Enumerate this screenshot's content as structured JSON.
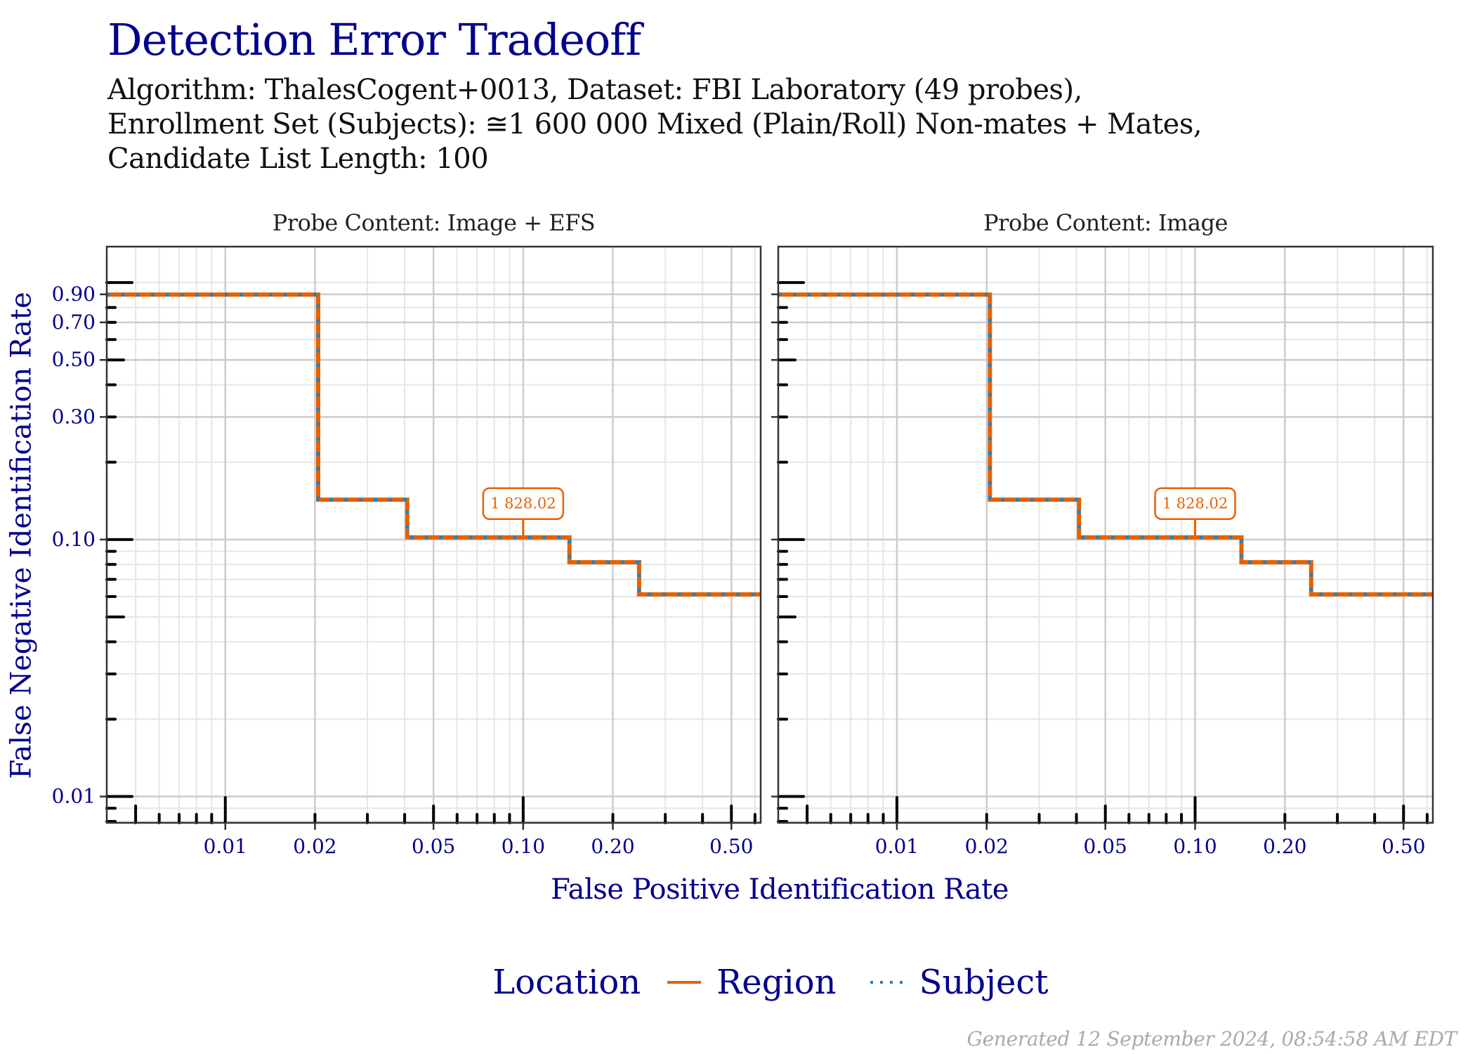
{
  "title": "Detection Error Tradeoff",
  "subtitle_lines": [
    "Algorithm: ThalesCogent+0013, Dataset: FBI Laboratory (49 probes),",
    "Enrollment Set (Subjects):  ≅1 600 000 Mixed (Plain/Roll) Non-mates + Mates,",
    "Candidate List Length: 100"
  ],
  "footer": "Generated 12 September 2024, 08:54:58 AM EDT",
  "legend": {
    "title": "Location",
    "items": [
      {
        "label": "Region",
        "color": "#E66100",
        "linetype": "solid"
      },
      {
        "label": "Subject",
        "color": "#1A85C9",
        "linetype": "dotted"
      }
    ]
  },
  "colors": {
    "accent": "#00008B",
    "region": "#E66100",
    "subject": "#1A85C9",
    "grid_major": "#cccccc",
    "grid_minor": "#e6e6e6"
  },
  "chart_data": {
    "type": "line",
    "title": "Detection Error Tradeoff",
    "xlabel": "False Positive Identification Rate",
    "ylabel": "False Negative Identification Rate",
    "x_scale": "log10",
    "y_scale": "log10",
    "xlim": [
      0.004,
      0.627
    ],
    "ylim": [
      0.0079,
      1.38
    ],
    "grid": true,
    "legend_position": "bottom",
    "x_ticks": [
      {
        "value": 0.01,
        "label": "0.01"
      },
      {
        "value": 0.02,
        "label": "0.02"
      },
      {
        "value": 0.05,
        "label": "0.05"
      },
      {
        "value": 0.1,
        "label": "0.10"
      },
      {
        "value": 0.2,
        "label": "0.20"
      },
      {
        "value": 0.5,
        "label": "0.50"
      }
    ],
    "y_ticks": [
      {
        "value": 0.9,
        "label": "0.90"
      },
      {
        "value": 0.7,
        "label": "0.70"
      },
      {
        "value": 0.5,
        "label": "0.50"
      },
      {
        "value": 0.3,
        "label": "0.30"
      },
      {
        "value": 0.1,
        "label": "0.10"
      },
      {
        "value": 0.01,
        "label": "0.01"
      }
    ],
    "x_minor_ticks": [
      0.005,
      0.006,
      0.007,
      0.008,
      0.009,
      0.03,
      0.04,
      0.06,
      0.07,
      0.08,
      0.09,
      0.3,
      0.4,
      0.6
    ],
    "y_minor_ticks": [
      1.0,
      0.9,
      0.8,
      0.7,
      0.6,
      0.5,
      0.4,
      0.3,
      0.2,
      0.09,
      0.08,
      0.07,
      0.06,
      0.05,
      0.04,
      0.03,
      0.02,
      0.009,
      0.008
    ],
    "panels": [
      {
        "strip": "Probe Content: Image + EFS",
        "series": [
          {
            "name": "Region",
            "x": [
              0.004,
              0.0205,
              0.0205,
              0.0408,
              0.0408,
              0.143,
              0.143,
              0.245,
              0.245,
              0.627
            ],
            "y": [
              0.898,
              0.898,
              0.1429,
              0.1429,
              0.102,
              0.102,
              0.0816,
              0.0816,
              0.0612,
              0.0612
            ]
          },
          {
            "name": "Subject",
            "x": [
              0.004,
              0.0205,
              0.0205,
              0.0408,
              0.0408,
              0.143,
              0.143,
              0.245,
              0.245,
              0.627
            ],
            "y": [
              0.898,
              0.898,
              0.1429,
              0.1429,
              0.102,
              0.102,
              0.0816,
              0.0816,
              0.0612,
              0.0612
            ]
          }
        ],
        "annotation": {
          "x": 0.1,
          "y": 0.102,
          "label": "1 828.02"
        }
      },
      {
        "strip": "Probe Content: Image",
        "series": [
          {
            "name": "Region",
            "x": [
              0.004,
              0.0205,
              0.0205,
              0.0408,
              0.0408,
              0.143,
              0.143,
              0.245,
              0.245,
              0.627
            ],
            "y": [
              0.898,
              0.898,
              0.1429,
              0.1429,
              0.102,
              0.102,
              0.0816,
              0.0816,
              0.0612,
              0.0612
            ]
          },
          {
            "name": "Subject",
            "x": [
              0.004,
              0.0205,
              0.0205,
              0.0408,
              0.0408,
              0.143,
              0.143,
              0.245,
              0.245,
              0.627
            ],
            "y": [
              0.898,
              0.898,
              0.1429,
              0.1429,
              0.102,
              0.102,
              0.0816,
              0.0816,
              0.0612,
              0.0612
            ]
          }
        ],
        "annotation": {
          "x": 0.1,
          "y": 0.102,
          "label": "1 828.02"
        }
      }
    ]
  }
}
